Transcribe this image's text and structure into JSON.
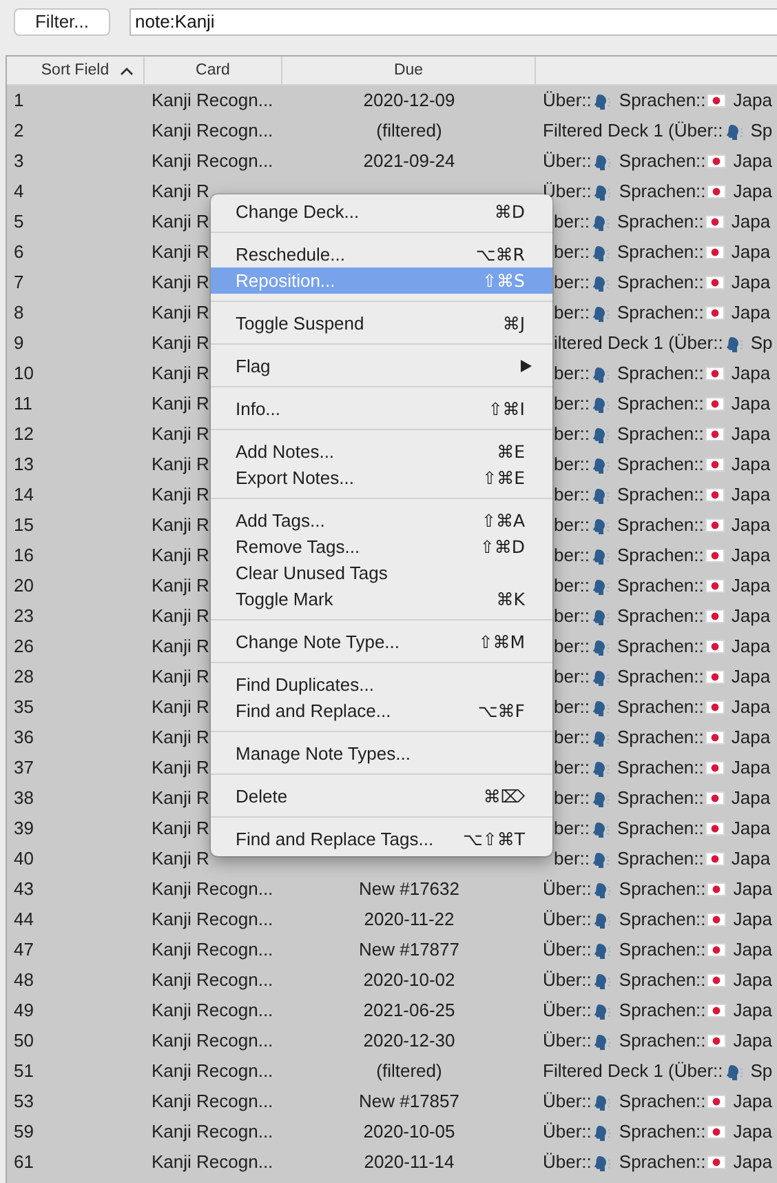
{
  "toolbar": {
    "filter_button": "Filter...",
    "search": {
      "value": "note:Kanji"
    }
  },
  "table": {
    "columns": [
      {
        "label": "Sort Field",
        "sorted": true
      },
      {
        "label": "Card",
        "sorted": false
      },
      {
        "label": "Due",
        "sorted": false
      }
    ],
    "rows": [
      {
        "sort_field": "1",
        "card": "Kanji Recogn...",
        "due": "2020-12-09",
        "deck": [
          "Über::",
          "Sprachen::",
          "Japa"
        ],
        "under_menu": false
      },
      {
        "sort_field": "2",
        "card": "Kanji Recogn...",
        "due": "(filtered)",
        "deck": [
          "Filtered Deck 1 (Über::",
          "Sp"
        ],
        "under_menu": false
      },
      {
        "sort_field": "3",
        "card": "Kanji Recogn...",
        "due": "2021-09-24",
        "deck": [
          "Über::",
          "Sprachen::",
          "Japa"
        ],
        "under_menu": false
      },
      {
        "sort_field": "4",
        "card": "Kanji R",
        "deck": [
          "Über::",
          "Sprachen::",
          "Japa"
        ],
        "under_menu": false
      },
      {
        "sort_field": "5",
        "card": "Kanji R",
        "deck": [
          "ber::",
          "Sprachen::",
          "Japa"
        ],
        "under_menu": true
      },
      {
        "sort_field": "6",
        "card": "Kanji R",
        "deck": [
          "ber::",
          "Sprachen::",
          "Japa"
        ],
        "under_menu": true
      },
      {
        "sort_field": "7",
        "card": "Kanji R",
        "deck": [
          "ber::",
          "Sprachen::",
          "Japa"
        ],
        "under_menu": true
      },
      {
        "sort_field": "8",
        "card": "Kanji R",
        "deck": [
          "ber::",
          "Sprachen::",
          "Japa"
        ],
        "under_menu": true
      },
      {
        "sort_field": "9",
        "card": "Kanji R",
        "deck": [
          "iltered Deck 1 (Über::",
          "Sp"
        ],
        "under_menu": true
      },
      {
        "sort_field": "10",
        "card": "Kanji R",
        "deck": [
          "ber::",
          "Sprachen::",
          "Japa"
        ],
        "under_menu": true
      },
      {
        "sort_field": "11",
        "card": "Kanji R",
        "deck": [
          "ber::",
          "Sprachen::",
          "Japa"
        ],
        "under_menu": true
      },
      {
        "sort_field": "12",
        "card": "Kanji R",
        "deck": [
          "ber::",
          "Sprachen::",
          "Japa"
        ],
        "under_menu": true
      },
      {
        "sort_field": "13",
        "card": "Kanji R",
        "deck": [
          "ber::",
          "Sprachen::",
          "Japa"
        ],
        "under_menu": true
      },
      {
        "sort_field": "14",
        "card": "Kanji R",
        "deck": [
          "ber::",
          "Sprachen::",
          "Japa"
        ],
        "under_menu": true
      },
      {
        "sort_field": "15",
        "card": "Kanji R",
        "deck": [
          "ber::",
          "Sprachen::",
          "Japa"
        ],
        "under_menu": true
      },
      {
        "sort_field": "16",
        "card": "Kanji R",
        "deck": [
          "ber::",
          "Sprachen::",
          "Japa"
        ],
        "under_menu": true
      },
      {
        "sort_field": "20",
        "card": "Kanji R",
        "deck": [
          "ber::",
          "Sprachen::",
          "Japa"
        ],
        "under_menu": true
      },
      {
        "sort_field": "23",
        "card": "Kanji R",
        "deck": [
          "ber::",
          "Sprachen::",
          "Japa"
        ],
        "under_menu": true
      },
      {
        "sort_field": "26",
        "card": "Kanji R",
        "deck": [
          "ber::",
          "Sprachen::",
          "Japa"
        ],
        "under_menu": true
      },
      {
        "sort_field": "28",
        "card": "Kanji R",
        "deck": [
          "ber::",
          "Sprachen::",
          "Japa"
        ],
        "under_menu": true
      },
      {
        "sort_field": "35",
        "card": "Kanji R",
        "deck": [
          "ber::",
          "Sprachen::",
          "Japa"
        ],
        "under_menu": true
      },
      {
        "sort_field": "36",
        "card": "Kanji R",
        "deck": [
          "ber::",
          "Sprachen::",
          "Japa"
        ],
        "under_menu": true
      },
      {
        "sort_field": "37",
        "card": "Kanji R",
        "deck": [
          "ber::",
          "Sprachen::",
          "Japa"
        ],
        "under_menu": true
      },
      {
        "sort_field": "38",
        "card": "Kanji R",
        "deck": [
          "ber::",
          "Sprachen::",
          "Japa"
        ],
        "under_menu": true
      },
      {
        "sort_field": "39",
        "card": "Kanji R",
        "deck": [
          "ber::",
          "Sprachen::",
          "Japa"
        ],
        "under_menu": true
      },
      {
        "sort_field": "40",
        "card": "Kanji R",
        "deck": [
          "ber::",
          "Sprachen::",
          "Japa"
        ],
        "under_menu": true
      },
      {
        "sort_field": "43",
        "card": "Kanji Recogn...",
        "due": "New #17632",
        "deck": [
          "Über::",
          "Sprachen::",
          "Japa"
        ],
        "under_menu": false
      },
      {
        "sort_field": "44",
        "card": "Kanji Recogn...",
        "due": "2020-11-22",
        "deck": [
          "Über::",
          "Sprachen::",
          "Japa"
        ],
        "under_menu": false
      },
      {
        "sort_field": "47",
        "card": "Kanji Recogn...",
        "due": "New #17877",
        "deck": [
          "Über::",
          "Sprachen::",
          "Japa"
        ],
        "under_menu": false
      },
      {
        "sort_field": "48",
        "card": "Kanji Recogn...",
        "due": "2020-10-02",
        "deck": [
          "Über::",
          "Sprachen::",
          "Japa"
        ],
        "under_menu": false
      },
      {
        "sort_field": "49",
        "card": "Kanji Recogn...",
        "due": "2021-06-25",
        "deck": [
          "Über::",
          "Sprachen::",
          "Japa"
        ],
        "under_menu": false
      },
      {
        "sort_field": "50",
        "card": "Kanji Recogn...",
        "due": "2020-12-30",
        "deck": [
          "Über::",
          "Sprachen::",
          "Japa"
        ],
        "under_menu": false
      },
      {
        "sort_field": "51",
        "card": "Kanji Recogn...",
        "due": "(filtered)",
        "deck": [
          "Filtered Deck 1 (Über::",
          "Sp"
        ],
        "under_menu": false
      },
      {
        "sort_field": "53",
        "card": "Kanji Recogn...",
        "due": "New #17857",
        "deck": [
          "Über::",
          "Sprachen::",
          "Japa"
        ],
        "under_menu": false
      },
      {
        "sort_field": "59",
        "card": "Kanji Recogn...",
        "due": "2020-10-05",
        "deck": [
          "Über::",
          "Sprachen::",
          "Japa"
        ],
        "under_menu": false
      },
      {
        "sort_field": "61",
        "card": "Kanji Recogn...",
        "due": "2020-11-14",
        "deck": [
          "Über::",
          "Sprachen::",
          "Japa"
        ],
        "under_menu": false
      }
    ]
  },
  "context_menu": {
    "groups": [
      [
        {
          "label": "Change Deck...",
          "shortcut": "⌘D",
          "selected": false
        }
      ],
      [
        {
          "label": "Reschedule...",
          "shortcut": "⌥⌘R",
          "selected": false
        },
        {
          "label": "Reposition...",
          "shortcut": "⇧⌘S",
          "selected": true
        }
      ],
      [
        {
          "label": "Toggle Suspend",
          "shortcut": "⌘J",
          "selected": false
        }
      ],
      [
        {
          "label": "Flag",
          "submenu": true,
          "selected": false
        }
      ],
      [
        {
          "label": "Info...",
          "shortcut": "⇧⌘I",
          "selected": false
        }
      ],
      [
        {
          "label": "Add Notes...",
          "shortcut": "⌘E",
          "selected": false
        },
        {
          "label": "Export Notes...",
          "shortcut": "⇧⌘E",
          "selected": false
        }
      ],
      [
        {
          "label": "Add Tags...",
          "shortcut": "⇧⌘A",
          "selected": false
        },
        {
          "label": "Remove Tags...",
          "shortcut": "⇧⌘D",
          "selected": false
        },
        {
          "label": "Clear Unused Tags",
          "selected": false
        },
        {
          "label": "Toggle Mark",
          "shortcut": "⌘K",
          "selected": false
        }
      ],
      [
        {
          "label": "Change Note Type...",
          "shortcut": "⇧⌘M",
          "selected": false
        }
      ],
      [
        {
          "label": "Find Duplicates...",
          "selected": false
        },
        {
          "label": "Find and Replace...",
          "shortcut": "⌥⌘F",
          "selected": false
        }
      ],
      [
        {
          "label": "Manage Note Types...",
          "selected": false
        }
      ],
      [
        {
          "label": "Delete",
          "shortcut": "⌘⌦",
          "selected": false
        }
      ],
      [
        {
          "label": "Find and Replace Tags...",
          "shortcut": "⌥⇧⌘T",
          "selected": false
        }
      ]
    ]
  }
}
